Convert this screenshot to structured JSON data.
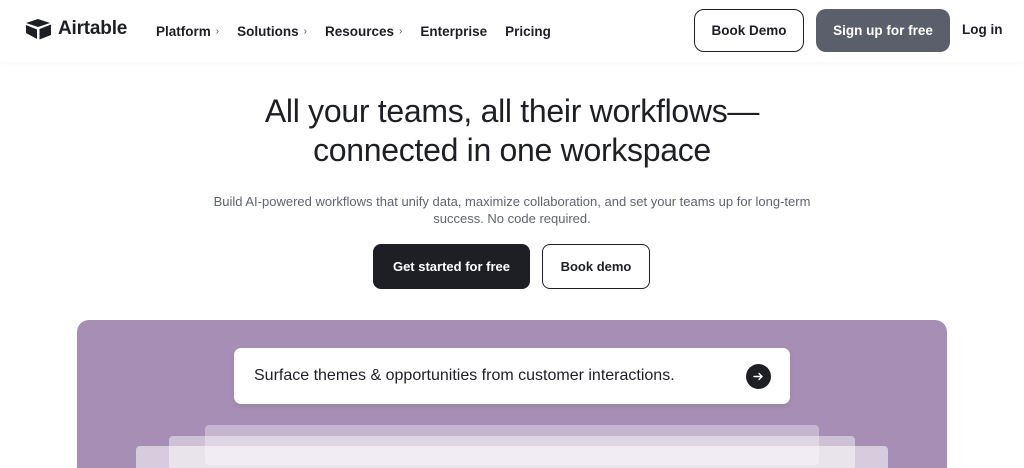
{
  "header": {
    "brand": "Airtable",
    "nav": [
      {
        "label": "Platform",
        "has_menu": true
      },
      {
        "label": "Solutions",
        "has_menu": true
      },
      {
        "label": "Resources",
        "has_menu": true
      },
      {
        "label": "Enterprise",
        "has_menu": false
      },
      {
        "label": "Pricing",
        "has_menu": false
      }
    ],
    "book_demo_label": "Book Demo",
    "signup_label": "Sign up for free",
    "login_label": "Log in"
  },
  "hero": {
    "title_line1": "All your teams, all their workflows—",
    "title_line2": "connected in one workspace",
    "subtitle": "Build AI-powered workflows that unify data, maximize collaboration, and set your teams up for long-term success. No code required.",
    "primary_cta": "Get started for free",
    "secondary_cta": "Book demo"
  },
  "showcase": {
    "prompt": "Surface themes & opportunities from customer interactions.",
    "submit_icon": "arrow-right-icon"
  },
  "colors": {
    "text": "#1d1f25",
    "signup_bg": "#5b5f6b",
    "panel_bg": "#a68eb4",
    "muted_text": "#60646f"
  }
}
